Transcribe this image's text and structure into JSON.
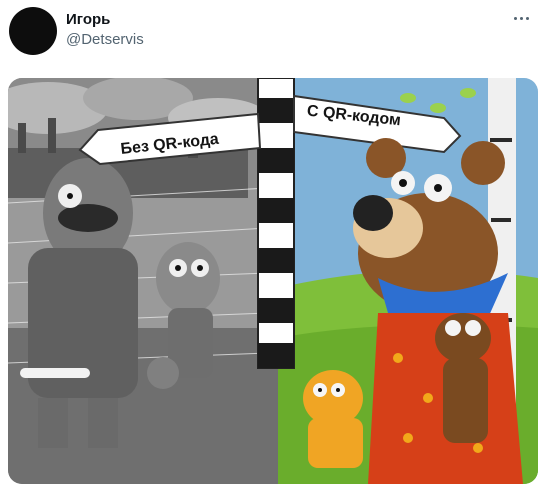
{
  "tweet": {
    "author_name": "Игорь",
    "author_handle": "@Detservis",
    "more_icon": "more-horizontal-icon"
  },
  "image": {
    "sign_left": "Без QR-кода",
    "sign_right": "С QR-кодом"
  },
  "colors": {
    "name": "#0f1419",
    "handle": "#536471",
    "avatar": "#0d0d0d"
  }
}
